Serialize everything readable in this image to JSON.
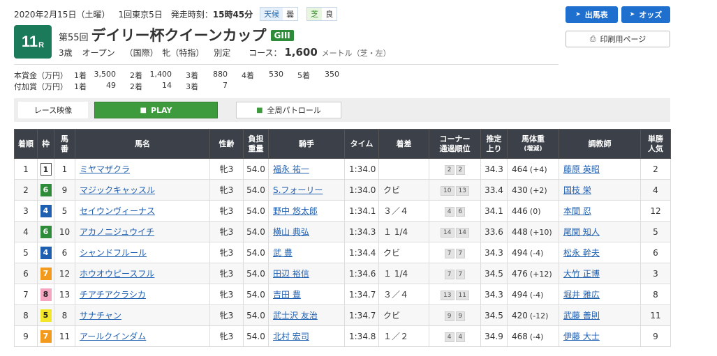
{
  "header": {
    "date": "2020年2月15日（土曜）",
    "meeting": "1回東京5日",
    "post_label": "発走時刻：",
    "post_time": "15時45分",
    "weather_label": "天候",
    "weather": "曇",
    "track_label": "芝",
    "track_condition": "良",
    "race_number": "11",
    "race_number_suffix": "R",
    "edition": "第55回",
    "race_name": "デイリー杯クイーンカップ",
    "grade": "GIII",
    "age": "3歳",
    "class": "オープン",
    "intl": "（国際）",
    "sex": "牝（特指）",
    "weight_rule": "別定",
    "course_label": "コース：",
    "distance": "1,600",
    "distance_unit": "メートル（芝・左）"
  },
  "prize": {
    "main": {
      "label": "本賞金（万円）",
      "items": [
        {
          "pos": "1着",
          "amount": "3,500"
        },
        {
          "pos": "2着",
          "amount": "1,400"
        },
        {
          "pos": "3着",
          "amount": "880"
        },
        {
          "pos": "4着",
          "amount": "530"
        },
        {
          "pos": "5着",
          "amount": "350"
        }
      ]
    },
    "added": {
      "label": "付加賞（万円）",
      "items": [
        {
          "pos": "1着",
          "amount": "49"
        },
        {
          "pos": "2着",
          "amount": "14"
        },
        {
          "pos": "3着",
          "amount": "7"
        }
      ]
    }
  },
  "buttons": {
    "entries": "出馬表",
    "odds": "オッズ",
    "print": "印刷用ページ",
    "race_video": "レース映像",
    "play": "PLAY",
    "patrol": "全周パトロール"
  },
  "table": {
    "headers": [
      "着順",
      "枠",
      "馬番",
      "馬名",
      "性齢",
      "負担重量",
      "騎手",
      "タイム",
      "着差",
      "コーナー通過順位",
      "推定上り",
      "馬体重(増減)",
      "調教師",
      "単勝人気"
    ],
    "rows": [
      {
        "rank": "1",
        "waku": "1",
        "num": "1",
        "horse": "ミヤマザクラ",
        "sex": "牝3",
        "wt": "54.0",
        "jockey": "福永 祐一",
        "time": "1:34.0",
        "margin": "",
        "c1": "2",
        "c2": "2",
        "last": "34.3",
        "bw": "464",
        "bwd": "(+4)",
        "trainer": "藤原 英昭",
        "pop": "2"
      },
      {
        "rank": "2",
        "waku": "6",
        "num": "9",
        "horse": "マジックキャッスル",
        "sex": "牝3",
        "wt": "54.0",
        "jockey": "S.フォーリー",
        "time": "1:34.0",
        "margin": "クビ",
        "c1": "10",
        "c2": "13",
        "last": "33.4",
        "bw": "430",
        "bwd": "(+2)",
        "trainer": "国枝 栄",
        "pop": "4"
      },
      {
        "rank": "3",
        "waku": "4",
        "num": "5",
        "horse": "セイウンヴィーナス",
        "sex": "牝3",
        "wt": "54.0",
        "jockey": "野中 悠太郎",
        "time": "1:34.1",
        "margin": "３／４",
        "c1": "4",
        "c2": "6",
        "last": "34.1",
        "bw": "446",
        "bwd": "(0)",
        "trainer": "本間 忍",
        "pop": "12"
      },
      {
        "rank": "4",
        "waku": "6",
        "num": "10",
        "horse": "アカノニジュウイチ",
        "sex": "牝3",
        "wt": "54.0",
        "jockey": "横山 典弘",
        "time": "1:34.3",
        "margin": "１ 1/4",
        "c1": "14",
        "c2": "14",
        "last": "33.6",
        "bw": "448",
        "bwd": "(+10)",
        "trainer": "尾関 知人",
        "pop": "5"
      },
      {
        "rank": "5",
        "waku": "4",
        "num": "6",
        "horse": "シャンドフルール",
        "sex": "牝3",
        "wt": "54.0",
        "jockey": "武 豊",
        "time": "1:34.4",
        "margin": "クビ",
        "c1": "7",
        "c2": "7",
        "last": "34.3",
        "bw": "494",
        "bwd": "(-4)",
        "trainer": "松永 幹夫",
        "pop": "6"
      },
      {
        "rank": "6",
        "waku": "7",
        "num": "12",
        "horse": "ホウオウピースフル",
        "sex": "牝3",
        "wt": "54.0",
        "jockey": "田辺 裕信",
        "time": "1:34.6",
        "margin": "１ 1/4",
        "c1": "7",
        "c2": "7",
        "last": "34.5",
        "bw": "476",
        "bwd": "(+12)",
        "trainer": "大竹 正博",
        "pop": "3"
      },
      {
        "rank": "7",
        "waku": "8",
        "num": "13",
        "horse": "チアチアクラシカ",
        "sex": "牝3",
        "wt": "54.0",
        "jockey": "吉田 豊",
        "time": "1:34.7",
        "margin": "３／４",
        "c1": "13",
        "c2": "11",
        "last": "34.3",
        "bw": "494",
        "bwd": "(-4)",
        "trainer": "堀井 雅広",
        "pop": "8"
      },
      {
        "rank": "8",
        "waku": "5",
        "num": "8",
        "horse": "サナチャン",
        "sex": "牝3",
        "wt": "54.0",
        "jockey": "武士沢 友治",
        "time": "1:34.7",
        "margin": "クビ",
        "c1": "9",
        "c2": "9",
        "last": "34.5",
        "bw": "420",
        "bwd": "(-12)",
        "trainer": "武藤 善則",
        "pop": "11"
      },
      {
        "rank": "9",
        "waku": "7",
        "num": "11",
        "horse": "アールクインダム",
        "sex": "牝3",
        "wt": "54.0",
        "jockey": "北村 宏司",
        "time": "1:34.8",
        "margin": "１／２",
        "c1": "4",
        "c2": "4",
        "last": "34.9",
        "bw": "468",
        "bwd": "(-4)",
        "trainer": "伊藤 大士",
        "pop": "9"
      }
    ]
  },
  "colors": {
    "waku_1": "#ffffff",
    "waku_2": "#222222",
    "waku_3": "#d9262b",
    "waku_4": "#1f5fb0",
    "waku_5": "#f3e52a",
    "waku_6": "#2e8b3a",
    "waku_7": "#f29a1e",
    "waku_8": "#f4a6c0",
    "accent_blue": "#1f6fcf",
    "race_green": "#1b7a5a"
  }
}
